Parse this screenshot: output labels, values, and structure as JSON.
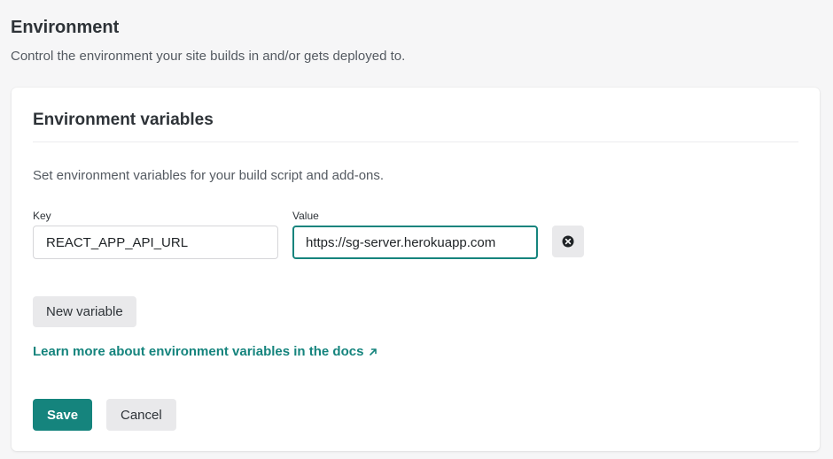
{
  "header": {
    "title": "Environment",
    "subtitle": "Control the environment your site builds in and/or gets deployed to."
  },
  "card": {
    "title": "Environment variables",
    "description": "Set environment variables for your build script and add-ons.",
    "variables": [
      {
        "key_label": "Key",
        "value_label": "Value",
        "key": "REACT_APP_API_URL",
        "value": "https://sg-server.herokuapp.com",
        "remove_icon": "close-circle-icon"
      }
    ],
    "new_variable_label": "New variable",
    "docs_link_label": "Learn more about environment variables in the docs",
    "docs_link_icon": "arrow-up-right-icon",
    "save_label": "Save",
    "cancel_label": "Cancel"
  },
  "colors": {
    "accent": "#15847d",
    "button_gray": "#e9e9eb",
    "text": "#2e3338",
    "muted_text": "#545a61",
    "background": "#f6f6f7"
  }
}
